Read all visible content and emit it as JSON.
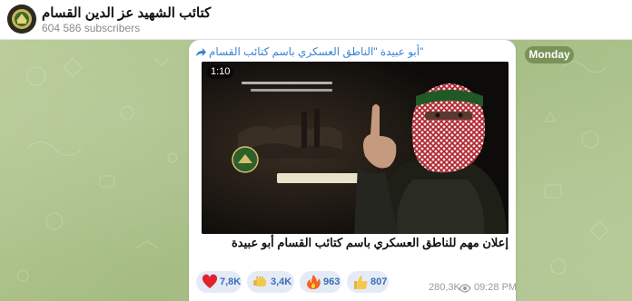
{
  "header": {
    "channel_title": "كتائب الشهيد عز الدين القسام",
    "subscribers": "604 586 subscribers"
  },
  "day_badge": "Monday",
  "message": {
    "forwarded_from": "أبو عبيدة \"الناطق العسكري باسم كتائب القسام\"",
    "video": {
      "duration": "1:10",
      "overlay_text_line1": "كَتَبَ بِدَمِ الشَّهيدِ كَلِمَةَ حَياةٍ",
      "overlay_text_line2": "بِطُوفانِ الأَقْصى",
      "logo_text": "طوفان الأقصى",
      "lower_caption": "أبو عبيدة / الناطق العسكري باسم القسام"
    },
    "caption": "إعلان مهم للناطق العسكري باسم كتائب القسام أبو عبيدة",
    "reactions": [
      {
        "emoji": "heart",
        "count": "7,8K"
      },
      {
        "emoji": "fist",
        "count": "3,4K"
      },
      {
        "emoji": "fire",
        "count": "963"
      },
      {
        "emoji": "thumbs-up",
        "count": "807"
      }
    ],
    "views": "280,3K",
    "time": "09:28 PM"
  },
  "colors": {
    "link_blue": "#3a84d3",
    "reaction_bg": "#e4ebf6",
    "chat_bg": "#a9c08a"
  }
}
